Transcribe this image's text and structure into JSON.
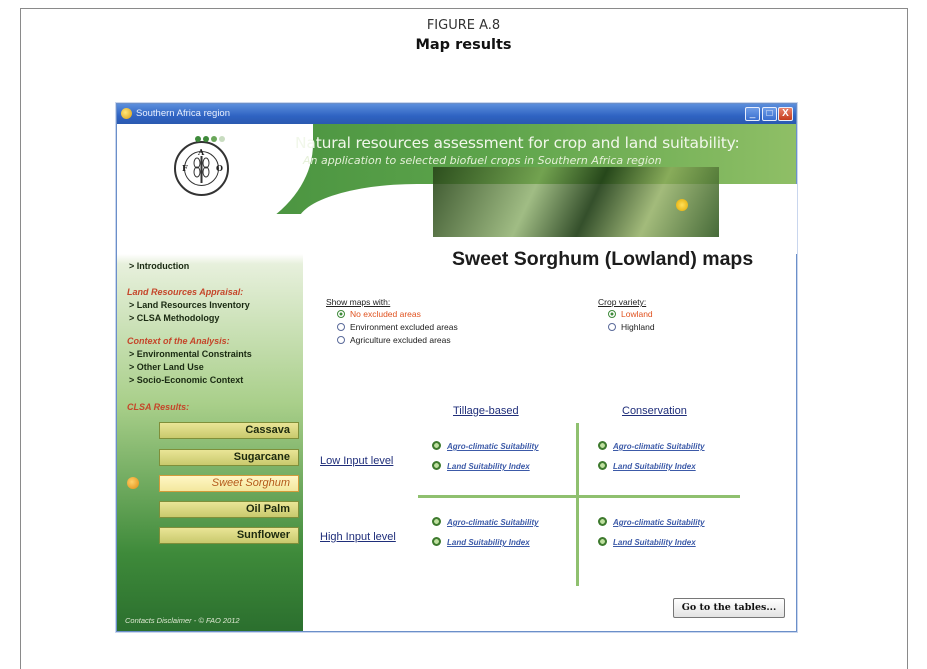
{
  "figure": {
    "number": "FIGURE A.8",
    "caption": "Map results"
  },
  "window": {
    "title": "Southern Africa region",
    "controls": {
      "minimize": "_",
      "maximize": "□",
      "close": "X"
    }
  },
  "header": {
    "logo_text": "FAO",
    "title": "Natural resources assessment for crop and land suitability:",
    "subtitle": "An application to selected biofuel crops in Southern Africa region"
  },
  "sidebar": {
    "introduction": "> Introduction",
    "section1_heading": "Land Resources Appraisal:",
    "section1_items": [
      "> Land Resources Inventory",
      "> CLSA Methodology"
    ],
    "section2_heading": "Context of the Analysis:",
    "section2_items": [
      "> Environmental Constraints",
      "> Other Land Use",
      "> Socio-Economic Context"
    ],
    "section3_heading": "CLSA Results:",
    "crops": [
      "Cassava",
      "Sugarcane",
      "Sweet Sorghum",
      "Oil Palm",
      "Sunflower"
    ],
    "active_crop": "Sweet Sorghum",
    "footer": "Contacts  Disclaimer - © FAO 2012"
  },
  "main": {
    "title": "Sweet Sorghum (Lowland) maps",
    "show_maps_label": "Show maps with:",
    "show_maps_options": [
      "No excluded areas",
      "Environment excluded areas",
      "Agriculture excluded areas"
    ],
    "show_maps_selected": "No excluded areas",
    "crop_variety_label": "Crop variety:",
    "crop_variety_options": [
      "Lowland",
      "Highland"
    ],
    "crop_variety_selected": "Lowland",
    "columns": [
      "Tillage-based",
      "Conservation"
    ],
    "rows": [
      "Low Input level",
      "High Input level"
    ],
    "link_agro": "Agro-climatic Suitability",
    "link_land": "Land Suitability Index",
    "goto_button": "Go to the tables..."
  },
  "colors": {
    "accent_green": "#3e8a3a",
    "grid_line": "#8fc06f",
    "selected_option": "#e0521f",
    "heading_red": "#c5462a",
    "link_blue": "#3c5aa8"
  }
}
